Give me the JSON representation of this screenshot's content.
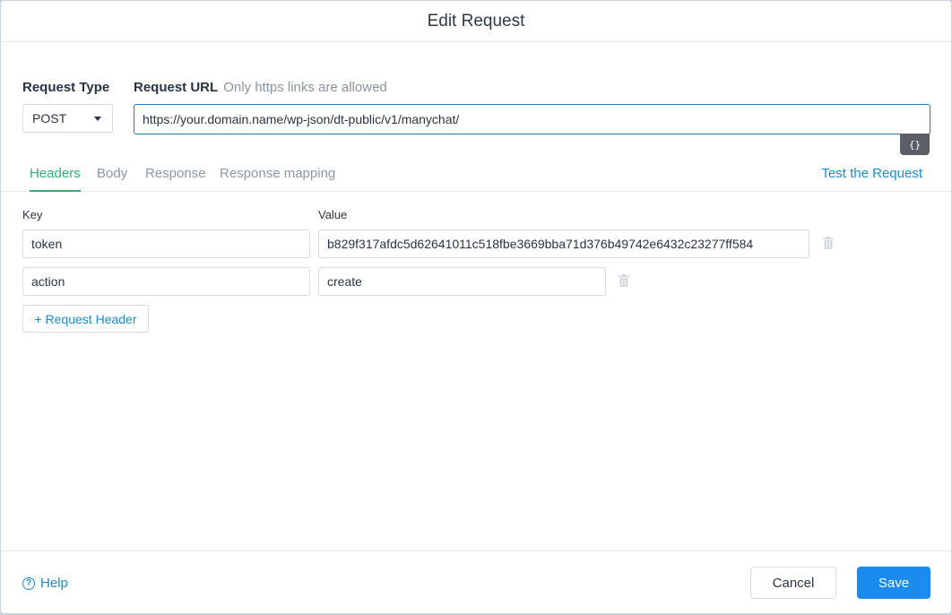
{
  "modal": {
    "title": "Edit Request"
  },
  "request": {
    "type_label": "Request Type",
    "type_value": "POST",
    "url_label": "Request URL",
    "url_hint": "Only https links are allowed",
    "url_value": "https://your.domain.name/wp-json/dt-public/v1/manychat/",
    "variables_button": "{}"
  },
  "tabs": [
    {
      "label": "Headers",
      "active": true
    },
    {
      "label": "Body",
      "active": false
    },
    {
      "label": "Response",
      "active": false
    },
    {
      "label": "Response mapping",
      "active": false
    }
  ],
  "test_link": "Test the Request",
  "headers": {
    "key_label": "Key",
    "value_label": "Value",
    "rows": [
      {
        "key": "token",
        "value": "b829f317afdc5d62641011c518fbe3669bba71d376b49742e6432c23277ff584"
      },
      {
        "key": "action",
        "value": "create"
      }
    ],
    "add_label": "+ Request Header"
  },
  "footer": {
    "help_label": "Help",
    "cancel_label": "Cancel",
    "save_label": "Save"
  },
  "colors": {
    "accent_tab": "#2bb27a",
    "link": "#1a8ccf",
    "primary_button": "#1a8cf0",
    "url_border": "#1a7ebc"
  },
  "icons": [
    "chevron-down-icon",
    "trash-icon",
    "help-circle-icon",
    "code-braces-icon"
  ]
}
